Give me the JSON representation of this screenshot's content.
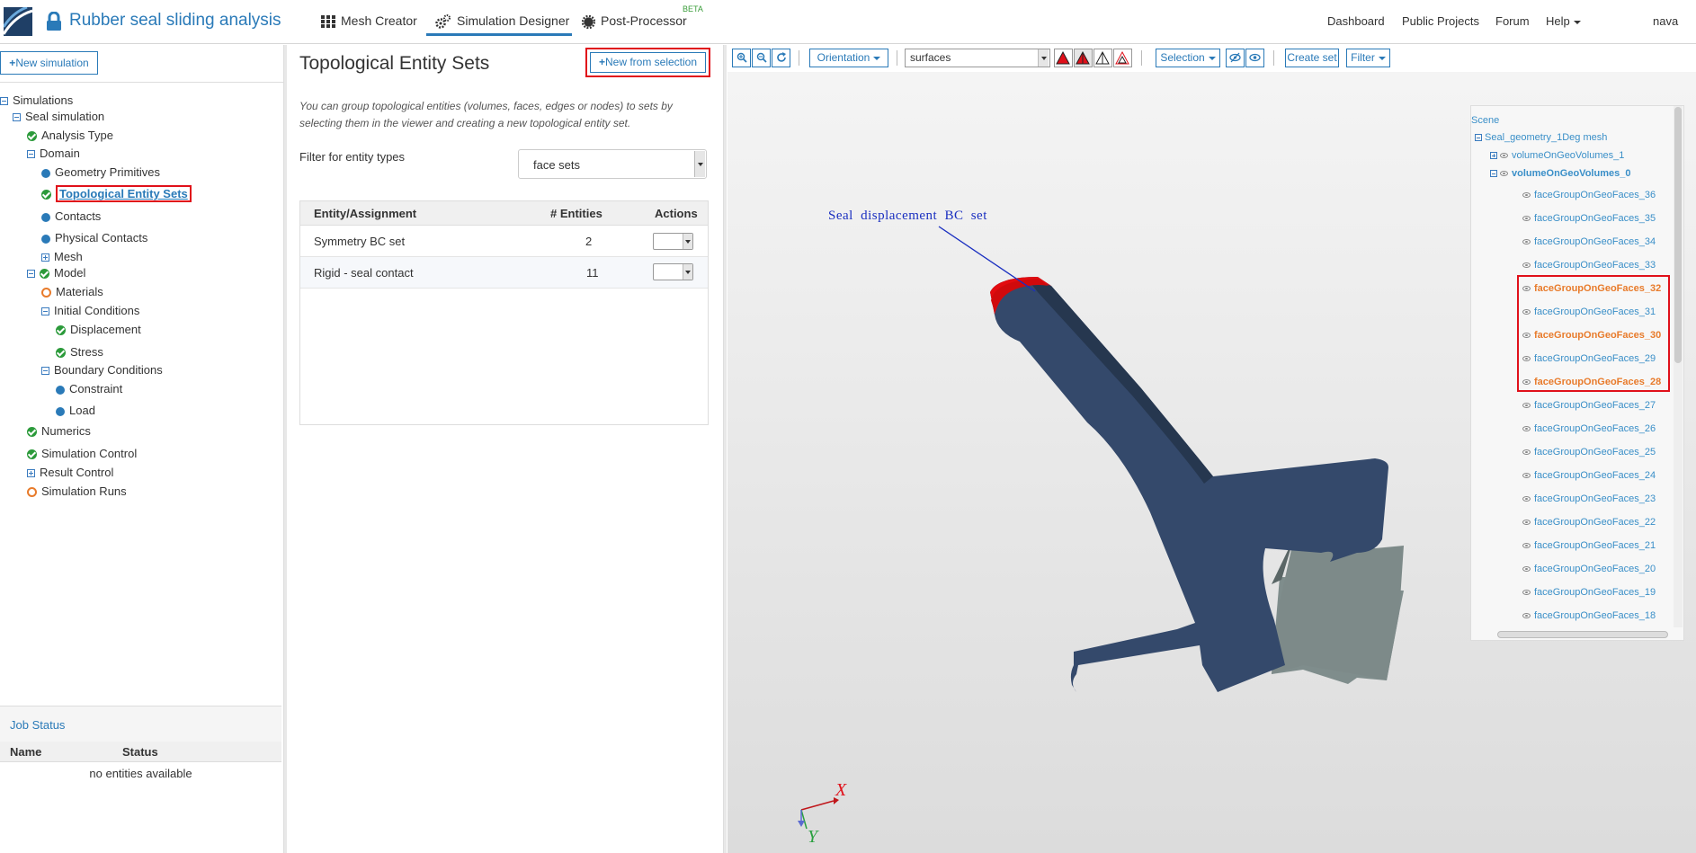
{
  "header": {
    "app_title": "Rubber seal sliding analysis",
    "nav": {
      "mesh_creator": "Mesh Creator",
      "simulation_designer": "Simulation Designer",
      "post_processor": "Post-Processor",
      "beta": "BETA"
    },
    "right": {
      "dashboard": "Dashboard",
      "public_projects": "Public Projects",
      "forum": "Forum",
      "help": "Help",
      "user": "nava"
    }
  },
  "sidebar": {
    "new_simulation": "New simulation",
    "tree": {
      "simulations": "Simulations",
      "seal_simulation": "Seal simulation",
      "analysis_type": "Analysis Type",
      "domain": "Domain",
      "geometry_primitives": "Geometry Primitives",
      "topological_entity_sets": "Topological Entity Sets",
      "contacts": "Contacts",
      "physical_contacts": "Physical Contacts",
      "mesh": "Mesh",
      "model": "Model",
      "materials": "Materials",
      "initial_conditions": "Initial Conditions",
      "displacement": "Displacement",
      "stress": "Stress",
      "boundary_conditions": "Boundary Conditions",
      "constraint": "Constraint",
      "load": "Load",
      "numerics": "Numerics",
      "simulation_control": "Simulation Control",
      "result_control": "Result Control",
      "simulation_runs": "Simulation Runs"
    },
    "job_status": {
      "title": "Job Status",
      "col_name": "Name",
      "col_status": "Status",
      "empty": "no entities available"
    }
  },
  "main": {
    "title": "Topological Entity Sets",
    "new_from_selection": "New from selection",
    "description": "You can group topological entities (volumes, faces, edges or nodes) to sets by selecting them in the viewer and creating a new topological entity set.",
    "filter_label": "Filter for entity types",
    "filter_value": "face sets",
    "table": {
      "headers": [
        "Entity/Assignment",
        "# Entities",
        "Actions"
      ],
      "rows": [
        {
          "name": "Symmetry BC set",
          "count": "2"
        },
        {
          "name": "Rigid - seal contact",
          "count": "11"
        }
      ]
    }
  },
  "viewer": {
    "toolbar": {
      "orientation": "Orientation",
      "surface_mode": "surfaces",
      "selection": "Selection",
      "create_set": "Create set",
      "filter": "Filter"
    },
    "annotation": "Seal displacement BC set",
    "axes": {
      "x": "X",
      "y": "Y"
    },
    "scene": {
      "root": "Scene",
      "mesh": "Seal_geometry_1Deg mesh",
      "volume_1": "volumeOnGeoVolumes_1",
      "volume_0": "volumeOnGeoVolumes_0",
      "faces": [
        "faceGroupOnGeoFaces_36",
        "faceGroupOnGeoFaces_35",
        "faceGroupOnGeoFaces_34",
        "faceGroupOnGeoFaces_33",
        "faceGroupOnGeoFaces_32",
        "faceGroupOnGeoFaces_31",
        "faceGroupOnGeoFaces_30",
        "faceGroupOnGeoFaces_29",
        "faceGroupOnGeoFaces_28",
        "faceGroupOnGeoFaces_27",
        "faceGroupOnGeoFaces_26",
        "faceGroupOnGeoFaces_25",
        "faceGroupOnGeoFaces_24",
        "faceGroupOnGeoFaces_23",
        "faceGroupOnGeoFaces_22",
        "faceGroupOnGeoFaces_21",
        "faceGroupOnGeoFaces_20",
        "faceGroupOnGeoFaces_19",
        "faceGroupOnGeoFaces_18"
      ]
    }
  },
  "colors": {
    "accent": "#2a7ab8",
    "highlight": "#e0101a",
    "seal": "#34496b",
    "rigid": "#7a8a8a"
  }
}
